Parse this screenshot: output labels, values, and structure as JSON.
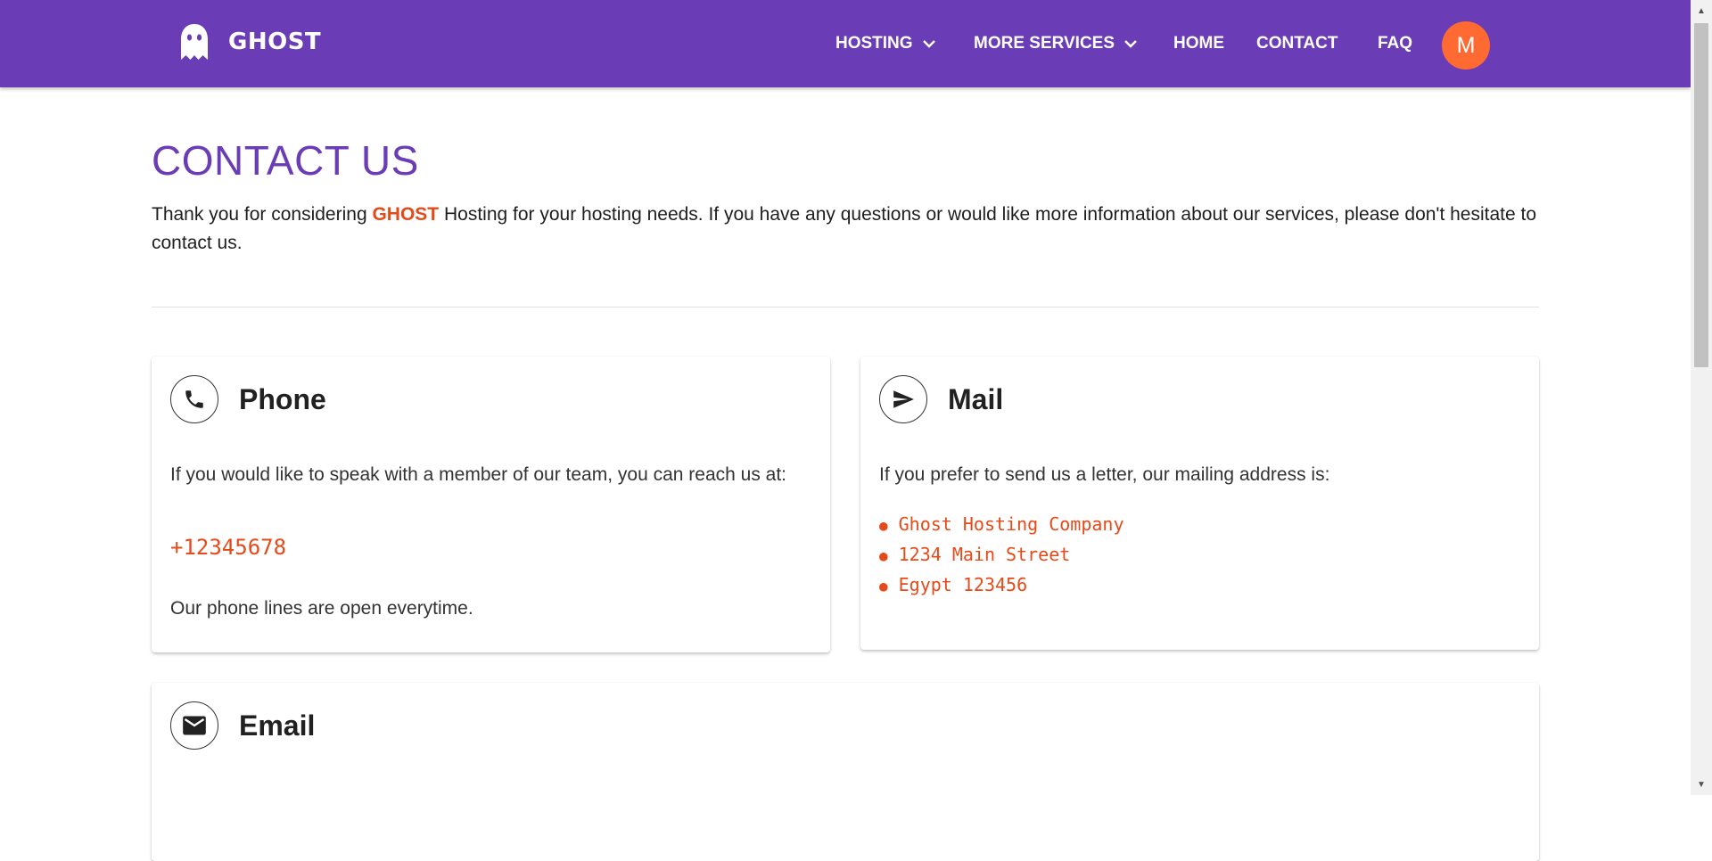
{
  "header": {
    "brand": "GHOST",
    "nav": [
      {
        "label": "HOSTING"
      },
      {
        "label": "MORE SERVICES"
      },
      {
        "label": "HOME"
      },
      {
        "label": "CONTACT"
      },
      {
        "label": "FAQ"
      }
    ],
    "avatar_initial": "M"
  },
  "page": {
    "title": "CONTACT US",
    "intro_before": "Thank you for considering ",
    "intro_brand": "GHOST",
    "intro_after": " Hosting for your hosting needs. If you have any questions or would like more information about our services, please don't hesitate to contact us."
  },
  "cards": {
    "phone": {
      "title": "Phone",
      "text": "If you would like to speak with a member of our team, you can reach us at:",
      "number": "+12345678",
      "note": "Our phone lines are open everytime."
    },
    "mail": {
      "title": "Mail",
      "text": "If you prefer to send us a letter, our mailing address is:",
      "address": [
        "Ghost Hosting Company",
        "1234 Main Street",
        "Egypt 123456"
      ]
    },
    "email": {
      "title": "Email"
    }
  },
  "icons": {
    "brand": "ghost-icon",
    "phone": "phone-icon",
    "mail": "send-icon",
    "email": "envelope-icon",
    "dropdown": "chevron-down-icon"
  },
  "colors": {
    "header_bg": "#6a3db6",
    "accent": "#e64a19",
    "avatar_bg": "#ff6a33",
    "title": "#6a3db6"
  }
}
